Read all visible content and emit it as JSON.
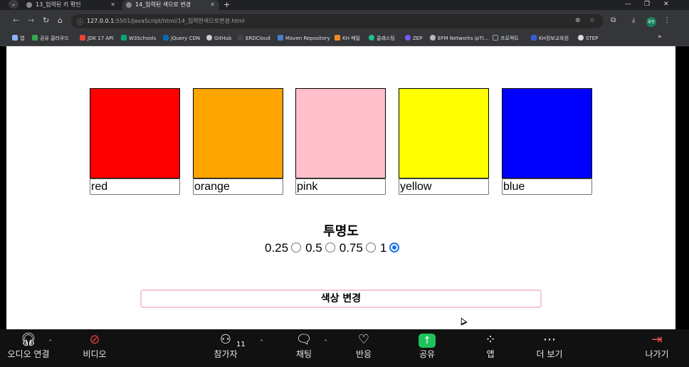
{
  "browser": {
    "tabs": [
      {
        "title": "13_입력된 키 확인",
        "active": false
      },
      {
        "title": "14_입력된 색으로 변경",
        "active": true
      }
    ],
    "url_host": "127.0.0.1",
    "url_rest": ":5501/JavaScript/html/14_입력한색으로변경.html",
    "profile_label": "동현",
    "bookmarks": [
      {
        "label": "앱",
        "color": "#8ab4f8"
      },
      {
        "label": "공유 클라우드",
        "color": "#34a853"
      },
      {
        "label": "JDK 17 API",
        "color": "#ea4335"
      },
      {
        "label": "W3Schools",
        "color": "#04aa6d"
      },
      {
        "label": "jQuery CDN",
        "color": "#0769ad"
      },
      {
        "label": "GitHub",
        "color": "#cccccc"
      },
      {
        "label": "ERDCloud",
        "color": "#444444"
      },
      {
        "label": "Maven Repository",
        "color": "#4a7bd0"
      },
      {
        "label": "KH 메일",
        "color": "#f28b20"
      },
      {
        "label": "클래스팅",
        "color": "#1ec28b"
      },
      {
        "label": "ZEP",
        "color": "#7a5af8"
      },
      {
        "label": "EFM Networks ipTI...",
        "color": "#bbbbbb"
      },
      {
        "label": "프로젝트",
        "color": "#9aa0a6"
      },
      {
        "label": "KH정보교육원",
        "color": "#3a5bd9"
      },
      {
        "label": "STEP",
        "color": "#dddddd"
      }
    ],
    "bookmarks_overflow": "»"
  },
  "page": {
    "swatches": [
      {
        "color": "#ff0000",
        "input": "red"
      },
      {
        "color": "#ffa500",
        "input": "orange"
      },
      {
        "color": "#ffc0cb",
        "input": "pink"
      },
      {
        "color": "#ffff00",
        "input": "yellow"
      },
      {
        "color": "#0000ff",
        "input": "blue"
      }
    ],
    "opacity_title": "투명도",
    "opacity_options": [
      {
        "label": "0.25",
        "checked": false
      },
      {
        "label": "0.5",
        "checked": false
      },
      {
        "label": "0.75",
        "checked": false
      },
      {
        "label": "1",
        "checked": true
      }
    ],
    "change_button": "색상 변경"
  },
  "meeting_bar": {
    "audio": "오디오 연결",
    "video": "비디오",
    "participants": "참가자",
    "participant_count": "11",
    "chat": "채팅",
    "reactions": "반응",
    "share": "공유",
    "apps": "앱",
    "more": "더 보기",
    "leave": "나가기"
  }
}
